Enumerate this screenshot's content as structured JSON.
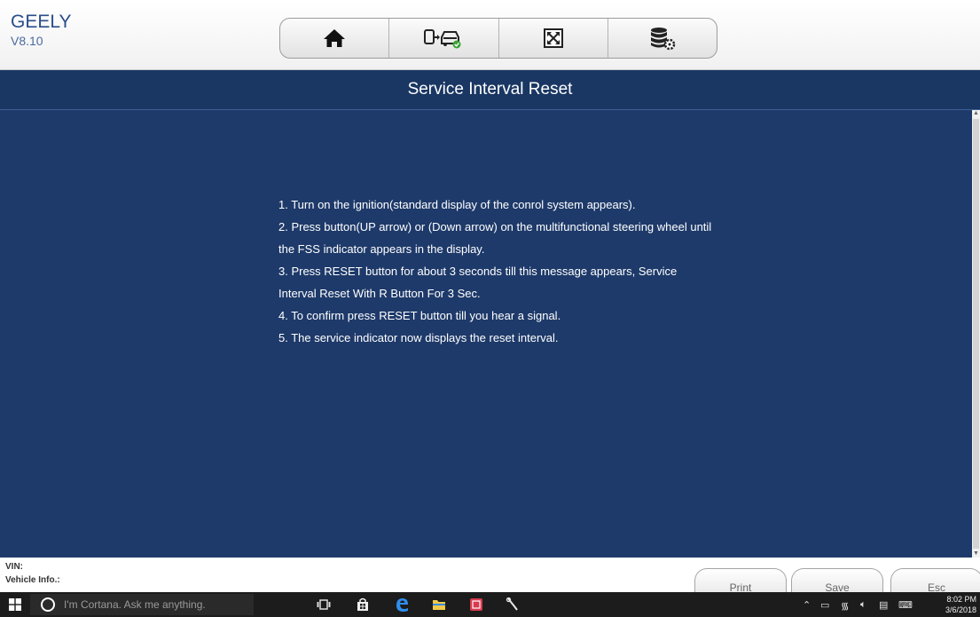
{
  "app": {
    "name": "GEELY",
    "version": "V8.10"
  },
  "toolbar": {
    "buttons": [
      {
        "name": "home",
        "icon": "home-icon"
      },
      {
        "name": "vehicle-switch",
        "icon": "vehicle-switch-icon"
      },
      {
        "name": "fullscreen",
        "icon": "fullscreen-icon"
      },
      {
        "name": "data-settings",
        "icon": "database-gear-icon"
      }
    ]
  },
  "page": {
    "title": "Service Interval Reset",
    "instructions": [
      "1. Turn on the ignition(standard display of the conrol system appears).",
      "2. Press button(UP arrow) or (Down arrow) on the multifunctional steering wheel until",
      "the FSS indicator appears in the display.",
      "3. Press RESET button for about 3 seconds till this message appears, Service",
      "Interval Reset With R Button For 3 Sec.",
      "4. To confirm press RESET button till you hear a signal.",
      "5. The service indicator now displays the reset interval."
    ]
  },
  "footer": {
    "vin_label": "VIN:",
    "vehicle_info_label": "Vehicle Info.:",
    "buttons": {
      "print": "Print",
      "save": "Save",
      "esc": "Esc"
    }
  },
  "taskbar": {
    "search_placeholder": "I'm Cortana. Ask me anything.",
    "clock_time": "8:02 PM",
    "clock_date": "3/6/2018"
  },
  "colors": {
    "brand": "#2a4e8c",
    "title_bar": "#1a3763",
    "content_bg": "#1e3a6a",
    "taskbar": "#1c1c1c"
  }
}
